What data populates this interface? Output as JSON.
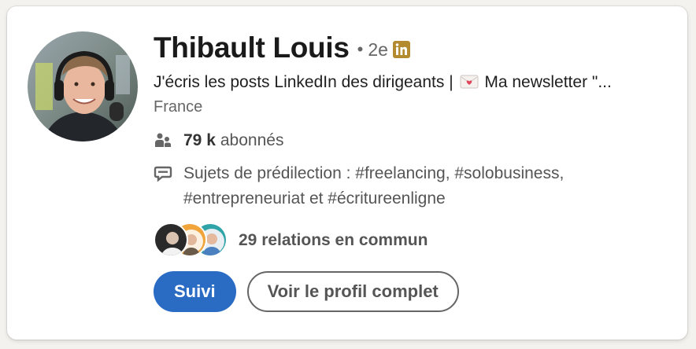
{
  "profile": {
    "name": "Thibault Louis",
    "separator": "•",
    "degree": "2e",
    "headline_before": "J'écris les posts LinkedIn des dirigeants |",
    "headline_after": "Ma newsletter \"...",
    "location": "France",
    "followers_count": "79 k",
    "followers_label": "abonnés",
    "topics": "Sujets de prédilection : #freelancing, #solobusiness, #entrepreneuriat et #écritureenligne",
    "mutual_connections": "29 relations en commun"
  },
  "actions": {
    "follow_label": "Suivi",
    "view_profile_label": "Voir le profil complet"
  },
  "icons": {
    "linkedin_badge": "linkedin-icon",
    "headline_emoji": "love-letter-icon",
    "followers": "people-icon",
    "topics": "speech-bubble-icon"
  },
  "colors": {
    "primary_button": "#2a6bc4",
    "linkedin_badge": "#b38a2e",
    "text_dark": "#1a1a1a",
    "text_muted": "#666666"
  }
}
